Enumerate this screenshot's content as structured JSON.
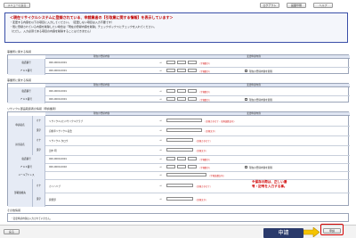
{
  "topbar": {
    "menu_label": "メニューに戻る",
    "right_buttons": [
      "ログアウト",
      "画面印刷",
      "ヘルプ"
    ]
  },
  "notice": {
    "title": "＜現在リサイクルシステムに登録されている、申請業者の【引取業に関する情報】を表示しています＞",
    "lines": [
      "・変更する内容を以下の項目に入力してください。（変更しない項目は入力不要です）",
      "・既に登録されている内容を削除したい場合は「現在の登録内容を削除」チェックボックスにチェックを入れてください。",
      "（ただし、入力必須である項目の内容を削除することはできません）"
    ]
  },
  "sections": {
    "office": "事業所に関する情報",
    "branch": "事業所に関する情報",
    "recycle": "リサイクル部品取扱者の情報（申請業者）",
    "other": "その他情報"
  },
  "headers": {
    "current": "現在の登録内容",
    "changed": "変更申請内容"
  },
  "office_rows": [
    {
      "label": "電話番号",
      "value": "000-0000-0001",
      "note": "（半角数字）"
    },
    {
      "label": "ＦＡＸ番号",
      "value": "000-0000-0001",
      "note": "（半角数字）",
      "check": "現在の登録内容を削除"
    }
  ],
  "branch_rows": [
    {
      "label": "電話番号",
      "value": "000-0000-0001",
      "note": "（半角数字）"
    },
    {
      "label": "ＦＡＸ番号",
      "value": "000-0000-0001",
      "note": "（半角数字）",
      "check": "現在の登録内容を削除"
    }
  ],
  "recycle_groups": [
    {
      "group": "申請者名",
      "rows": [
        {
          "sub": "カナ",
          "value": "リサイクル(カ)リサイクルクラブ",
          "note": "（全角カタカナ・全角英数記号）"
        },
        {
          "sub": "漢字",
          "value": "自動車リサイクル協会",
          "note": "（全角文字）"
        }
      ]
    },
    {
      "group": "担当者名",
      "rows": [
        {
          "sub": "カナ",
          "value": "リサイクル タロウ",
          "note": "（全角カタカナ）"
        },
        {
          "sub": "漢字",
          "value": "田中 明",
          "note": "（全角文字）"
        }
      ]
    },
    {
      "group": "電話番号",
      "rows": [
        {
          "sub": "",
          "value": "000-0000-0001",
          "note": "（半角数字）"
        }
      ]
    },
    {
      "group": "ＦＡＸ番号",
      "rows": [
        {
          "sub": "",
          "value": "000-0000-0002",
          "note": "（半角数字）",
          "check": "現在の登録内容を削除"
        }
      ]
    },
    {
      "group": "メールアドレス",
      "rows": [
        {
          "sub": "",
          "value": "",
          "note": "（半角英数記号）"
        }
      ]
    },
    {
      "group": "部署連絡先",
      "rows": [
        {
          "sub": "カナ",
          "value": "カイハツブ",
          "note": "（全角カタカナ）"
        },
        {
          "sub": "漢字",
          "value": "開発部",
          "note": "（全角文字）"
        }
      ]
    }
  ],
  "warning": "※保存の際は、正しい番号・記号を入力する事。",
  "other_text": "・変更申請内容は入力されていません。",
  "footer": {
    "back_label": "戻る",
    "submit_label": "申請",
    "callout": "申請"
  }
}
